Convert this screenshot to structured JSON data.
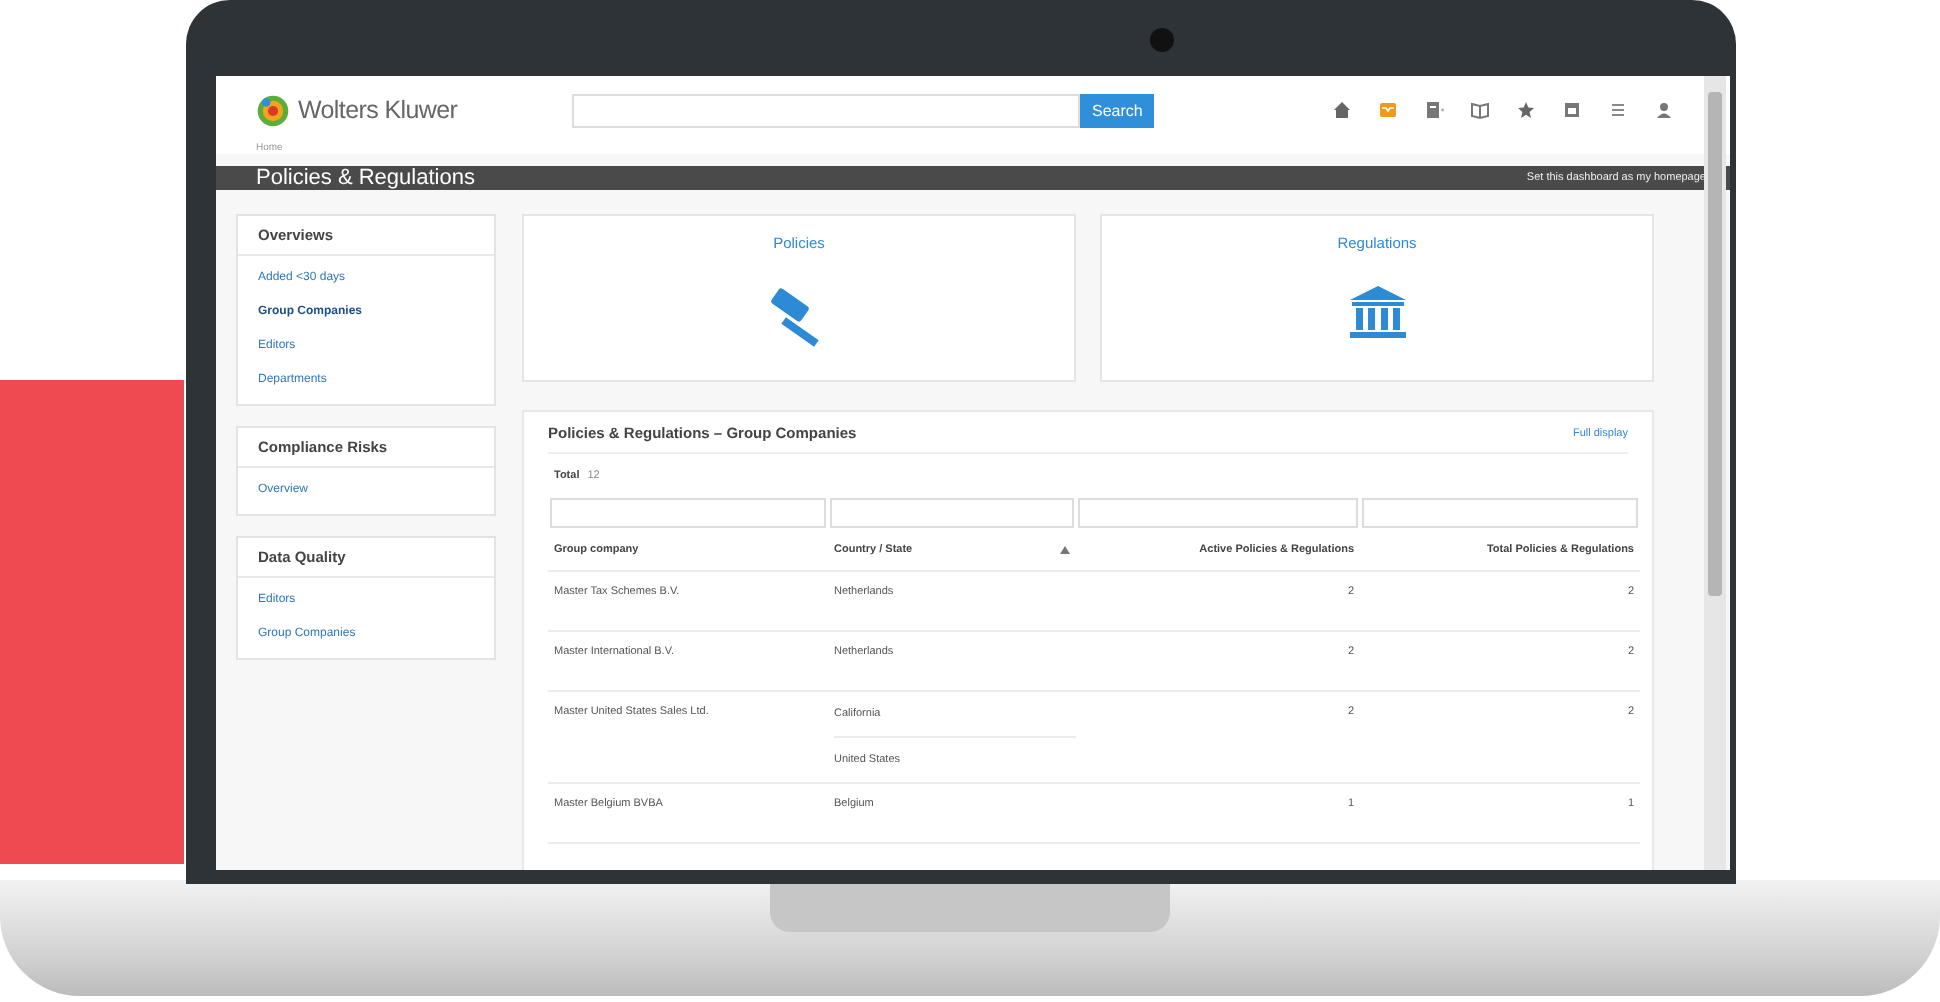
{
  "brand": {
    "name": "Wolters Kluwer"
  },
  "search": {
    "button": "Search"
  },
  "breadcrumb": "Home",
  "page_title": "Policies & Regulations",
  "homepage_link": "Set this dashboard as my homepage",
  "sidebar": [
    {
      "title": "Overviews",
      "items": [
        {
          "label": "Added <30 days",
          "selected": false
        },
        {
          "label": "Group Companies",
          "selected": true
        },
        {
          "label": "Editors",
          "selected": false
        },
        {
          "label": "Departments",
          "selected": false
        }
      ]
    },
    {
      "title": "Compliance Risks",
      "items": [
        {
          "label": "Overview",
          "selected": false
        }
      ]
    },
    {
      "title": "Data Quality",
      "items": [
        {
          "label": "Editors",
          "selected": false
        },
        {
          "label": "Group Companies",
          "selected": false
        }
      ]
    }
  ],
  "tiles": [
    {
      "label": "Policies",
      "kind": "gavel"
    },
    {
      "label": "Regulations",
      "kind": "bank"
    }
  ],
  "table_panel": {
    "title": "Policies & Regulations – Group Companies",
    "action": "Full display",
    "total_label": "Total",
    "total": "12",
    "columns": [
      {
        "label": "Group company",
        "sorted": false
      },
      {
        "label": "Country / State",
        "sorted": true
      },
      {
        "label": "Active Policies & Regulations",
        "sorted": false
      },
      {
        "label": "Total Policies & Regulations",
        "sorted": false
      }
    ],
    "rows": [
      {
        "company": "Master Tax Schemes B.V.",
        "countries": [
          "Netherlands"
        ],
        "active": "2",
        "total": "2"
      },
      {
        "company": "Master International B.V.",
        "countries": [
          "Netherlands"
        ],
        "active": "2",
        "total": "2"
      },
      {
        "company": "Master United States Sales Ltd.",
        "countries": [
          "California",
          "United States"
        ],
        "active": "2",
        "total": "2"
      },
      {
        "company": "Master Belgium BVBA",
        "countries": [
          "Belgium"
        ],
        "active": "1",
        "total": "1"
      }
    ]
  }
}
